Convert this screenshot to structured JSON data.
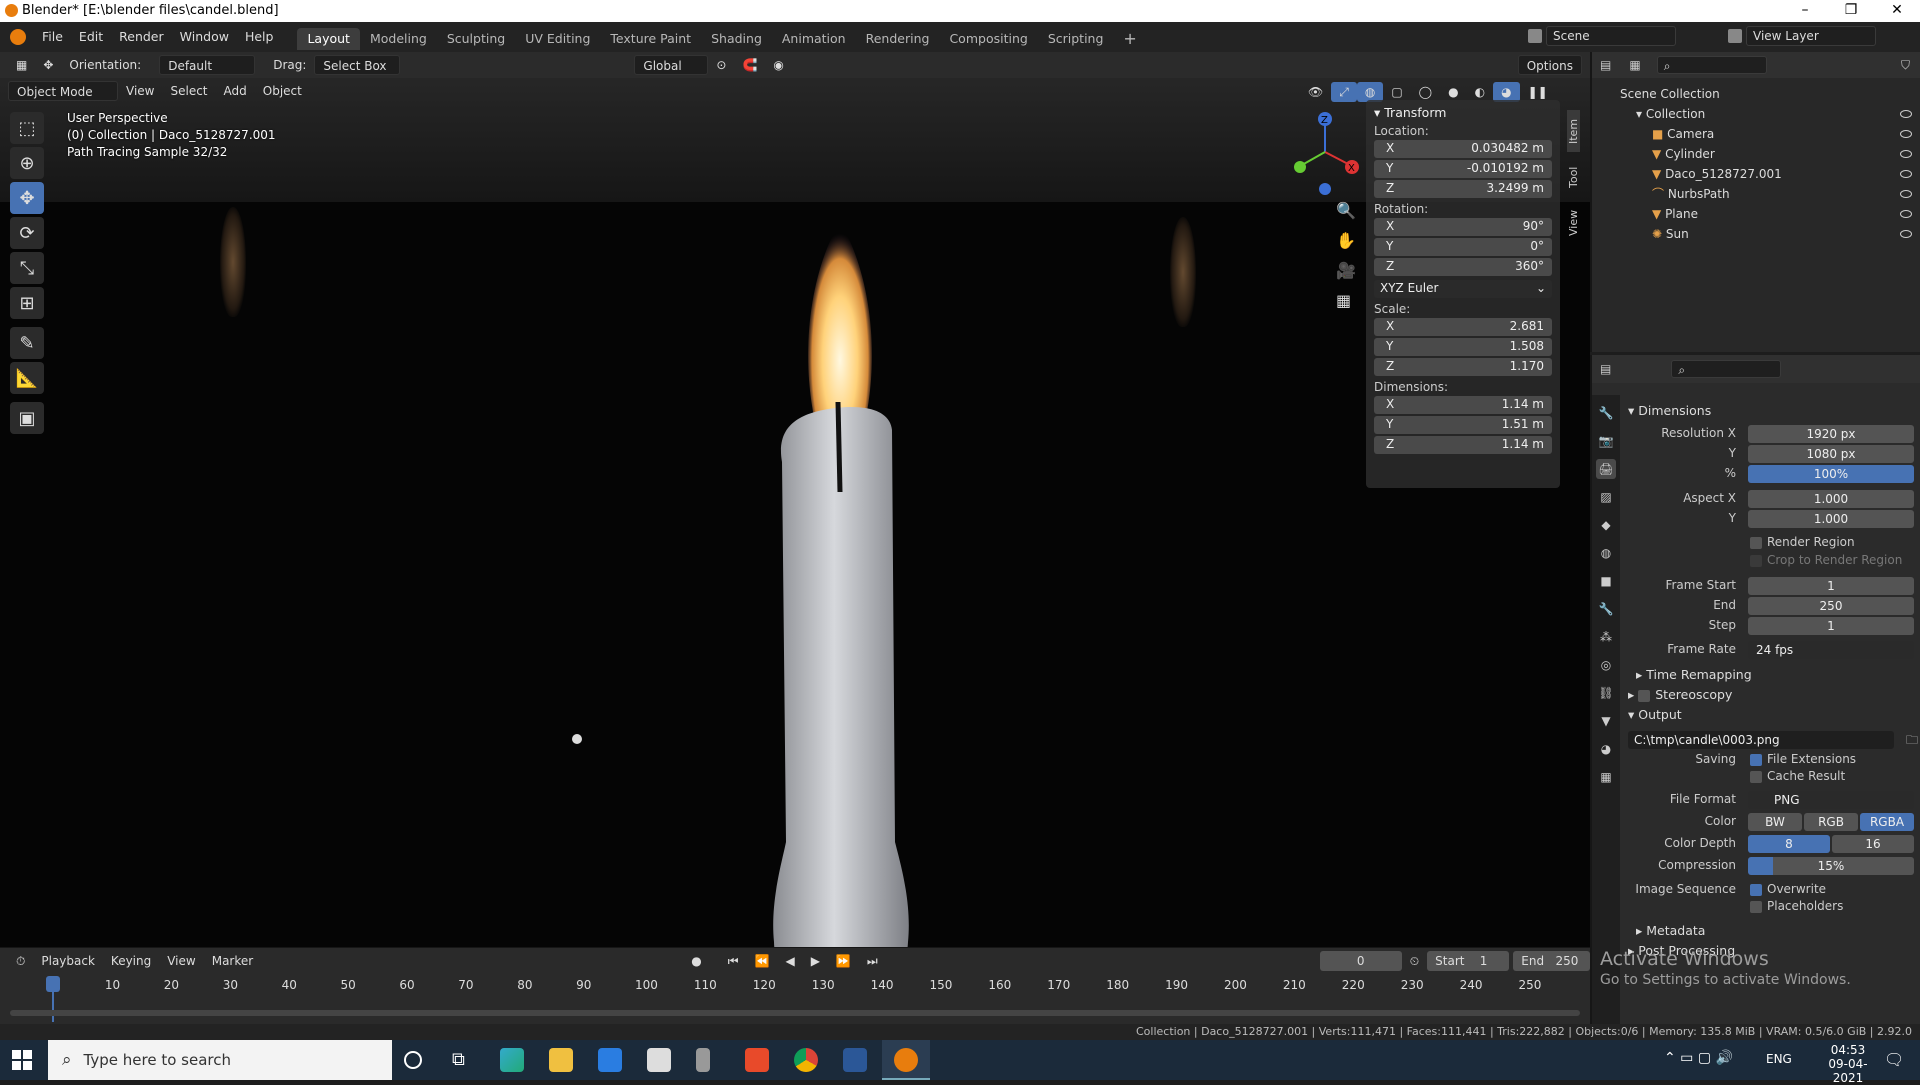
{
  "window": {
    "title": "Blender* [E:\\blender files\\candel.blend]"
  },
  "menu": [
    "File",
    "Edit",
    "Render",
    "Window",
    "Help"
  ],
  "workspaces": [
    "Layout",
    "Modeling",
    "Sculpting",
    "UV Editing",
    "Texture Paint",
    "Shading",
    "Animation",
    "Rendering",
    "Compositing",
    "Scripting"
  ],
  "active_workspace": "Layout",
  "scene": {
    "label": "Scene",
    "view_layer": "View Layer"
  },
  "tool_header": {
    "orientation_label": "Orientation:",
    "orientation": "Default",
    "drag_label": "Drag:",
    "drag": "Select Box",
    "transform_orientation": "Global",
    "options": "Options"
  },
  "viewport_header": {
    "mode": "Object Mode",
    "menus": [
      "View",
      "Select",
      "Add",
      "Object"
    ]
  },
  "viewport_info": {
    "line1": "User Perspective",
    "line2": "(0) Collection | Daco_5128727.001",
    "line3": "Path Tracing Sample 32/32"
  },
  "transform": {
    "title": "Transform",
    "location_label": "Location:",
    "location": {
      "x": "0.030482 m",
      "y": "-0.010192 m",
      "z": "3.2499 m"
    },
    "rotation_label": "Rotation:",
    "rotation": {
      "x": "90°",
      "y": "0°",
      "z": "360°"
    },
    "rotation_mode": "XYZ Euler",
    "scale_label": "Scale:",
    "scale": {
      "x": "2.681",
      "y": "1.508",
      "z": "1.170"
    },
    "dimensions_label": "Dimensions:",
    "dimensions": {
      "x": "1.14 m",
      "y": "1.51 m",
      "z": "1.14 m"
    }
  },
  "npanel_tabs": [
    "Item",
    "Tool",
    "View"
  ],
  "outliner": {
    "root": "Scene Collection",
    "collection": "Collection",
    "items": [
      "Camera",
      "Cylinder",
      "Daco_5128727.001",
      "NurbsPath",
      "Plane",
      "Sun"
    ]
  },
  "properties": {
    "dimensions_title": "Dimensions",
    "resolution_x_label": "Resolution X",
    "resolution_x": "1920 px",
    "y_label": "Y",
    "resolution_y": "1080 px",
    "pct_label": "%",
    "resolution_pct": "100%",
    "aspect_x_label": "Aspect X",
    "aspect_x": "1.000",
    "aspect_y_label": "Y",
    "aspect_y": "1.000",
    "render_region": "Render Region",
    "crop_region": "Crop to Render Region",
    "frame_start_label": "Frame Start",
    "frame_start": "1",
    "end_label": "End",
    "frame_end": "250",
    "step_label": "Step",
    "frame_step": "1",
    "frame_rate_label": "Frame Rate",
    "frame_rate": "24 fps",
    "time_remapping": "Time Remapping",
    "stereoscopy": "Stereoscopy",
    "output_title": "Output",
    "output_path": "C:\\tmp\\candle\\0003.png",
    "saving_label": "Saving",
    "file_extensions": "File Extensions",
    "cache_result": "Cache Result",
    "file_format_label": "File Format",
    "file_format": "PNG",
    "color_label": "Color",
    "color_options": [
      "BW",
      "RGB",
      "RGBA"
    ],
    "color_depth_label": "Color Depth",
    "color_depth_options": [
      "8",
      "16"
    ],
    "compression_label": "Compression",
    "compression": "15%",
    "image_sequence_label": "Image Sequence",
    "overwrite": "Overwrite",
    "placeholders": "Placeholders",
    "metadata": "Metadata",
    "post_processing": "Post Processing"
  },
  "timeline": {
    "menus": [
      "Playback",
      "Keying",
      "View",
      "Marker"
    ],
    "current_frame": "0",
    "start_label": "Start",
    "start": "1",
    "end_label": "End",
    "end": "250",
    "ticks": [
      "0",
      "10",
      "20",
      "30",
      "40",
      "50",
      "60",
      "70",
      "80",
      "90",
      "100",
      "110",
      "120",
      "130",
      "140",
      "150",
      "160",
      "170",
      "180",
      "190",
      "200",
      "210",
      "220",
      "230",
      "240",
      "250"
    ]
  },
  "statusbar": {
    "text": "Collection | Daco_5128727.001 | Verts:111,471 | Faces:111,441 | Tris:222,882 | Objects:0/6 | Memory: 135.8 MiB | VRAM: 0.5/6.0 GiB | 2.92.0"
  },
  "activate": {
    "line1": "Activate Windows",
    "line2": "Go to Settings to activate Windows."
  },
  "taskbar": {
    "search_placeholder": "Type here to search",
    "lang": "ENG",
    "time": "04:53",
    "date": "09-04-2021"
  },
  "colors": {
    "accent": "#4772b3",
    "flame": "#ffd27a",
    "candle": "#c9ccd0"
  }
}
